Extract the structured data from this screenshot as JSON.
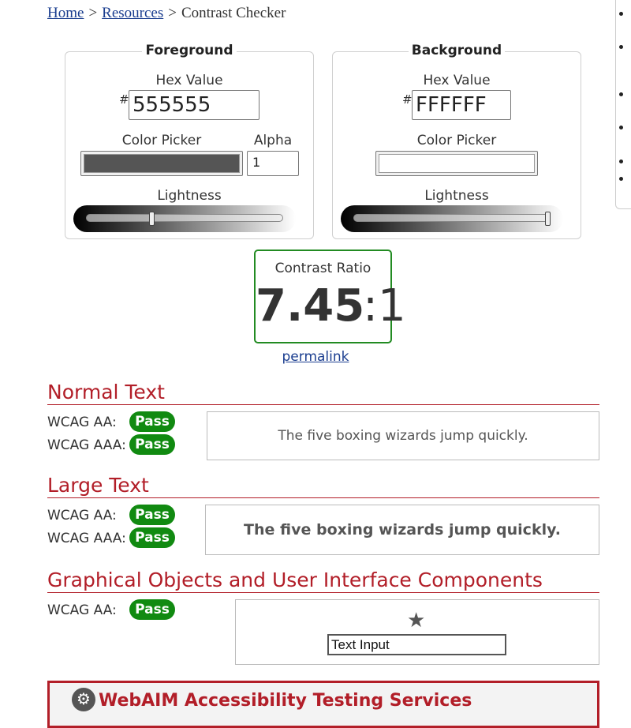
{
  "breadcrumb": {
    "home": "Home",
    "separator": ">",
    "resources": "Resources",
    "current": "Contrast Checker"
  },
  "foreground": {
    "legend": "Foreground",
    "hex_label": "Hex Value",
    "hash": "#",
    "hex_value": "555555",
    "picker_label": "Color Picker",
    "picker_color": "#555555",
    "alpha_label": "Alpha",
    "alpha_value": "1",
    "lightness_label": "Lightness",
    "lightness_level": 0.33
  },
  "background": {
    "legend": "Background",
    "hex_label": "Hex Value",
    "hash": "#",
    "hex_value": "FFFFFF",
    "picker_label": "Color Picker",
    "picker_color": "#FFFFFF",
    "lightness_label": "Lightness",
    "lightness_level": 1.0
  },
  "contrast": {
    "label": "Contrast Ratio",
    "ratio": "7.45",
    "suffix": ":1",
    "permalink": "permalink"
  },
  "normal_text": {
    "heading": "Normal Text",
    "aa_label": "WCAG AA:",
    "aa_result": "Pass",
    "aaa_label": "WCAG AAA:",
    "aaa_result": "Pass",
    "sample": "The five boxing wizards jump quickly."
  },
  "large_text": {
    "heading": "Large Text",
    "aa_label": "WCAG AA:",
    "aa_result": "Pass",
    "aaa_label": "WCAG AAA:",
    "aaa_result": "Pass",
    "sample": "The five boxing wizards jump quickly."
  },
  "graphical": {
    "heading": "Graphical Objects and User Interface Components",
    "aa_label": "WCAG AA:",
    "aa_result": "Pass",
    "star_glyph": "★",
    "input_value": "Text Input"
  },
  "banner": {
    "icon": "gear-head-icon",
    "title": "WebAIM Accessibility Testing Services"
  },
  "colors": {
    "link": "#1a3d8f",
    "heading_red": "#b21e28",
    "pass_green": "#118a11",
    "ratio_border": "#228b22"
  }
}
